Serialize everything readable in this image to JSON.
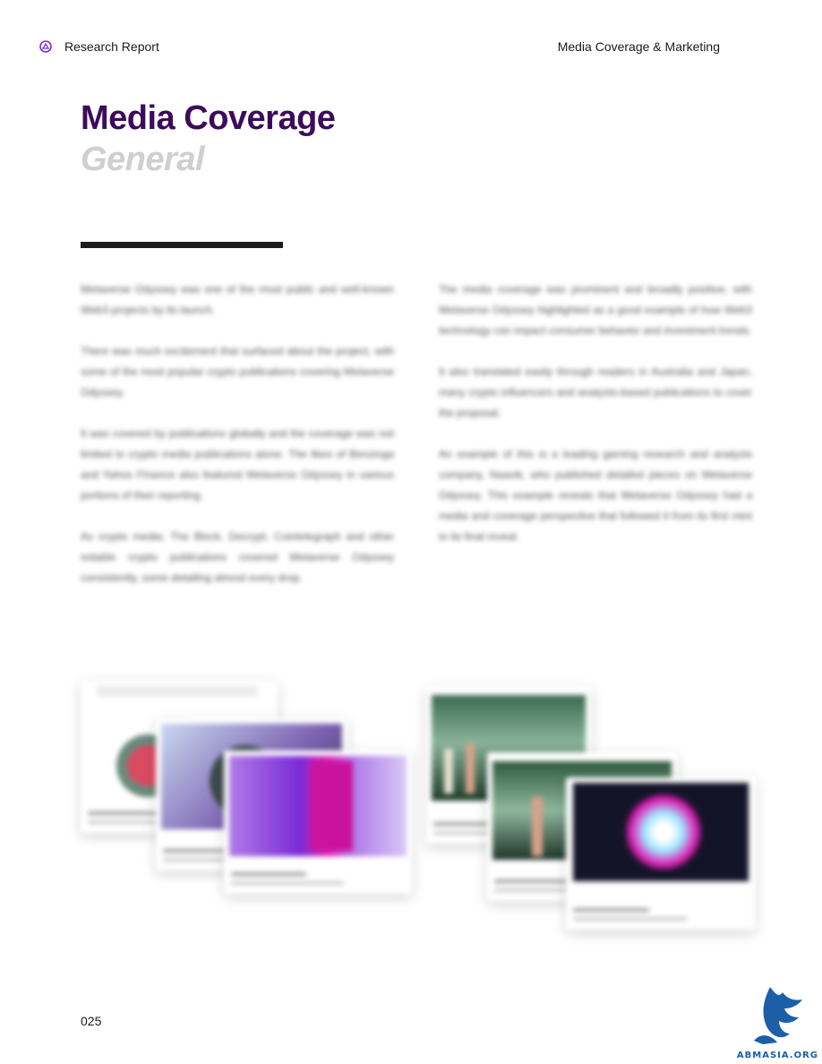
{
  "header": {
    "left_label": "Research Report",
    "right_label": "Media Coverage & Marketing"
  },
  "title": "Media Coverage",
  "subtitle": "General",
  "columns": {
    "left": [
      "Metaverse Odyssey was one of the most public and well-known Web3 projects by its launch.",
      "There was much excitement that surfaced about the project, with some of the most popular crypto publications covering Metaverse Odyssey.",
      "It was covered by publications globally and the coverage was not limited to crypto media publications alone. The likes of Benzinga and Yahoo Finance also featured Metaverse Odyssey in various portions of their reporting.",
      "As crypto media, The Block, Decrypt, Cointelegraph and other notable crypto publications covered Metaverse Odyssey consistently, some detailing almost every drop."
    ],
    "right": [
      "The media coverage was prominent and broadly positive, with Metaverse Odyssey highlighted as a good example of how Web3 technology can impact consumer behavior and investment trends.",
      "It also translated easily through readers in Australia and Japan, many crypto influencers and analysts-based publications to cover the proposal.",
      "An example of this is a leading gaming research and analysis company, Naavik, who published detailed pieces on Metaverse Odyssey. This example reveals that Metaverse Odyssey had a media and coverage perspective that followed it from its first mint to its final reveal."
    ]
  },
  "page_number": "025",
  "watermark": {
    "text": "ABMASIA.ORG",
    "color": "#1c5fa8"
  },
  "colors": {
    "title": "#3d0a5c",
    "subtitle": "#cfcfd2",
    "accent_purple": "#7a2bd6",
    "accent_magenta": "#e01fb4"
  }
}
